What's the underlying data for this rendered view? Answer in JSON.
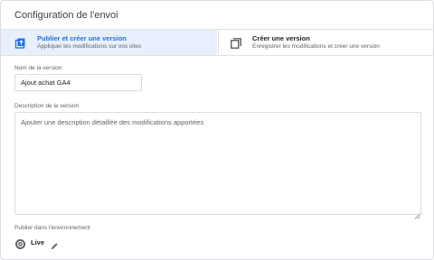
{
  "header": {
    "title": "Configuration de l'envoi"
  },
  "options": [
    {
      "label": "Publier et créer une version",
      "description": "Appliquer les modifications sur vos sites",
      "icon": "publish-icon",
      "selected": true
    },
    {
      "label": "Créer une version",
      "description": "Enregistrer les modifications et créer une version",
      "icon": "copy-icon",
      "selected": false
    }
  ],
  "version_name": {
    "label": "Nom de la version",
    "value": "Ajout achat GA4"
  },
  "version_description": {
    "label": "Description de la version",
    "placeholder": "Ajouter une description détaillée des modifications apportées",
    "value": ""
  },
  "environment": {
    "label": "Publier dans l'environnement",
    "name": "Live",
    "icon": "environment-icon",
    "edit_icon": "pencil-icon"
  },
  "colors": {
    "accent": "#1a73e8",
    "selected_bg": "#e8f0fe",
    "border": "#dadce0"
  }
}
